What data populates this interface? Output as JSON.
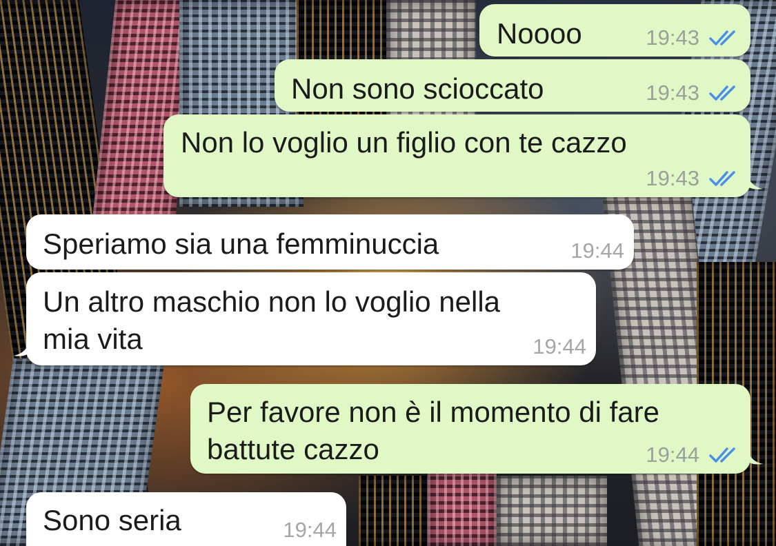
{
  "colors": {
    "outgoing_bubble": "#e0f7c6",
    "incoming_bubble": "#ffffff",
    "read_checks": "#4a8fe7",
    "time_text": "#9aa19a"
  },
  "messages": [
    {
      "direction": "outgoing",
      "text": "Noooo",
      "time": "19:43",
      "status_icon": "double-check-read-icon"
    },
    {
      "direction": "outgoing",
      "text": "Non sono scioccato",
      "time": "19:43",
      "status_icon": "double-check-read-icon"
    },
    {
      "direction": "outgoing",
      "text": "Non lo voglio un figlio con te cazzo",
      "time": "19:43",
      "status_icon": "double-check-read-icon"
    },
    {
      "direction": "incoming",
      "text": "Speriamo sia una femminuccia",
      "time": "19:44"
    },
    {
      "direction": "incoming",
      "text": "Un altro maschio non lo voglio nella\nmia vita",
      "time": "19:44"
    },
    {
      "direction": "outgoing",
      "text": "Per favore non è il momento di fare\nbattute cazzo",
      "time": "19:44",
      "status_icon": "double-check-read-icon"
    },
    {
      "direction": "incoming",
      "text": "Sono seria",
      "time": "19:44"
    }
  ]
}
